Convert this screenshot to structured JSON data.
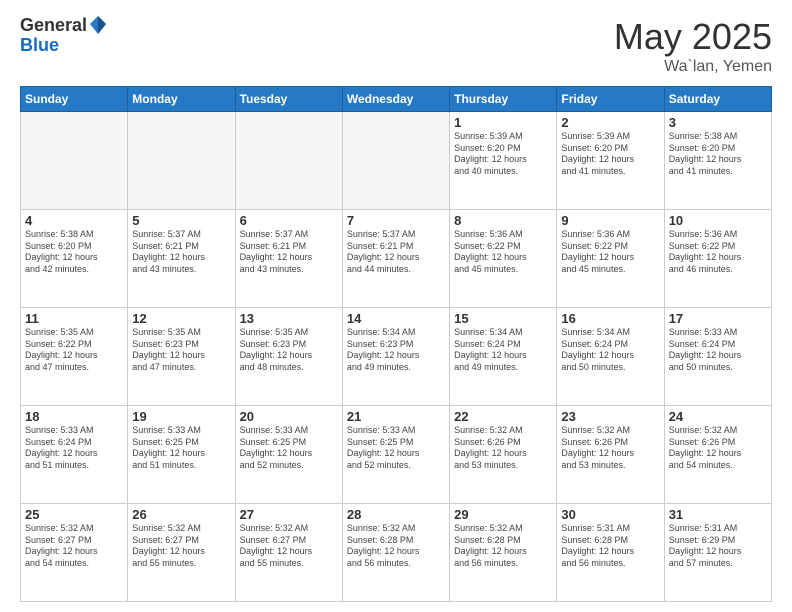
{
  "header": {
    "logo_general": "General",
    "logo_blue": "Blue",
    "month": "May 2025",
    "location": "Wa`lan, Yemen"
  },
  "days_of_week": [
    "Sunday",
    "Monday",
    "Tuesday",
    "Wednesday",
    "Thursday",
    "Friday",
    "Saturday"
  ],
  "weeks": [
    [
      {
        "day": "",
        "info": "",
        "empty": true
      },
      {
        "day": "",
        "info": "",
        "empty": true
      },
      {
        "day": "",
        "info": "",
        "empty": true
      },
      {
        "day": "",
        "info": "",
        "empty": true
      },
      {
        "day": "1",
        "info": "Sunrise: 5:39 AM\nSunset: 6:20 PM\nDaylight: 12 hours\nand 40 minutes."
      },
      {
        "day": "2",
        "info": "Sunrise: 5:39 AM\nSunset: 6:20 PM\nDaylight: 12 hours\nand 41 minutes."
      },
      {
        "day": "3",
        "info": "Sunrise: 5:38 AM\nSunset: 6:20 PM\nDaylight: 12 hours\nand 41 minutes."
      }
    ],
    [
      {
        "day": "4",
        "info": "Sunrise: 5:38 AM\nSunset: 6:20 PM\nDaylight: 12 hours\nand 42 minutes."
      },
      {
        "day": "5",
        "info": "Sunrise: 5:37 AM\nSunset: 6:21 PM\nDaylight: 12 hours\nand 43 minutes."
      },
      {
        "day": "6",
        "info": "Sunrise: 5:37 AM\nSunset: 6:21 PM\nDaylight: 12 hours\nand 43 minutes."
      },
      {
        "day": "7",
        "info": "Sunrise: 5:37 AM\nSunset: 6:21 PM\nDaylight: 12 hours\nand 44 minutes."
      },
      {
        "day": "8",
        "info": "Sunrise: 5:36 AM\nSunset: 6:22 PM\nDaylight: 12 hours\nand 45 minutes."
      },
      {
        "day": "9",
        "info": "Sunrise: 5:36 AM\nSunset: 6:22 PM\nDaylight: 12 hours\nand 45 minutes."
      },
      {
        "day": "10",
        "info": "Sunrise: 5:36 AM\nSunset: 6:22 PM\nDaylight: 12 hours\nand 46 minutes."
      }
    ],
    [
      {
        "day": "11",
        "info": "Sunrise: 5:35 AM\nSunset: 6:22 PM\nDaylight: 12 hours\nand 47 minutes."
      },
      {
        "day": "12",
        "info": "Sunrise: 5:35 AM\nSunset: 6:23 PM\nDaylight: 12 hours\nand 47 minutes."
      },
      {
        "day": "13",
        "info": "Sunrise: 5:35 AM\nSunset: 6:23 PM\nDaylight: 12 hours\nand 48 minutes."
      },
      {
        "day": "14",
        "info": "Sunrise: 5:34 AM\nSunset: 6:23 PM\nDaylight: 12 hours\nand 49 minutes."
      },
      {
        "day": "15",
        "info": "Sunrise: 5:34 AM\nSunset: 6:24 PM\nDaylight: 12 hours\nand 49 minutes."
      },
      {
        "day": "16",
        "info": "Sunrise: 5:34 AM\nSunset: 6:24 PM\nDaylight: 12 hours\nand 50 minutes."
      },
      {
        "day": "17",
        "info": "Sunrise: 5:33 AM\nSunset: 6:24 PM\nDaylight: 12 hours\nand 50 minutes."
      }
    ],
    [
      {
        "day": "18",
        "info": "Sunrise: 5:33 AM\nSunset: 6:24 PM\nDaylight: 12 hours\nand 51 minutes."
      },
      {
        "day": "19",
        "info": "Sunrise: 5:33 AM\nSunset: 6:25 PM\nDaylight: 12 hours\nand 51 minutes."
      },
      {
        "day": "20",
        "info": "Sunrise: 5:33 AM\nSunset: 6:25 PM\nDaylight: 12 hours\nand 52 minutes."
      },
      {
        "day": "21",
        "info": "Sunrise: 5:33 AM\nSunset: 6:25 PM\nDaylight: 12 hours\nand 52 minutes."
      },
      {
        "day": "22",
        "info": "Sunrise: 5:32 AM\nSunset: 6:26 PM\nDaylight: 12 hours\nand 53 minutes."
      },
      {
        "day": "23",
        "info": "Sunrise: 5:32 AM\nSunset: 6:26 PM\nDaylight: 12 hours\nand 53 minutes."
      },
      {
        "day": "24",
        "info": "Sunrise: 5:32 AM\nSunset: 6:26 PM\nDaylight: 12 hours\nand 54 minutes."
      }
    ],
    [
      {
        "day": "25",
        "info": "Sunrise: 5:32 AM\nSunset: 6:27 PM\nDaylight: 12 hours\nand 54 minutes."
      },
      {
        "day": "26",
        "info": "Sunrise: 5:32 AM\nSunset: 6:27 PM\nDaylight: 12 hours\nand 55 minutes."
      },
      {
        "day": "27",
        "info": "Sunrise: 5:32 AM\nSunset: 6:27 PM\nDaylight: 12 hours\nand 55 minutes."
      },
      {
        "day": "28",
        "info": "Sunrise: 5:32 AM\nSunset: 6:28 PM\nDaylight: 12 hours\nand 56 minutes."
      },
      {
        "day": "29",
        "info": "Sunrise: 5:32 AM\nSunset: 6:28 PM\nDaylight: 12 hours\nand 56 minutes."
      },
      {
        "day": "30",
        "info": "Sunrise: 5:31 AM\nSunset: 6:28 PM\nDaylight: 12 hours\nand 56 minutes."
      },
      {
        "day": "31",
        "info": "Sunrise: 5:31 AM\nSunset: 6:29 PM\nDaylight: 12 hours\nand 57 minutes."
      }
    ]
  ]
}
